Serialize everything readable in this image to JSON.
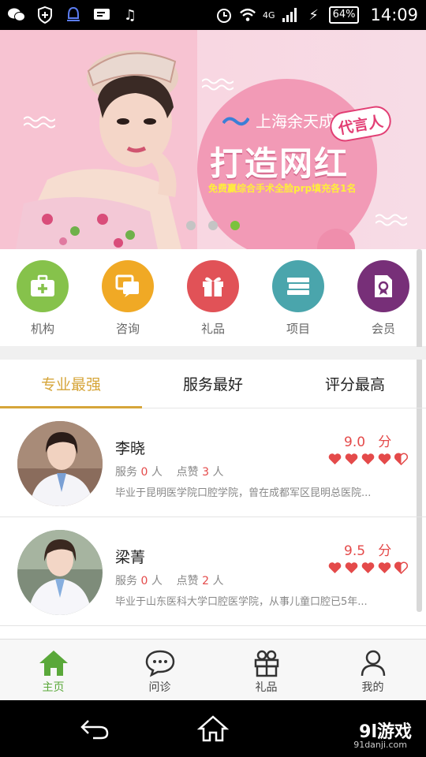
{
  "status_bar": {
    "battery": "64%",
    "network": "4G",
    "time": "14:09",
    "icons": [
      "wechat-icon",
      "shield-icon",
      "bell-icon",
      "message-icon",
      "music-icon",
      "alarm-icon",
      "wifi-icon",
      "signal-icon",
      "charging-icon"
    ]
  },
  "banner": {
    "brand": "上海余天成",
    "headline": "打造网红",
    "subline": "免费赢综合手术全脸prp填充各1名",
    "badge": "代言人",
    "slides": 3,
    "active_slide": 3
  },
  "categories": [
    {
      "label": "机构",
      "icon": "hospital-kit-icon",
      "color": "#86c24b"
    },
    {
      "label": "咨询",
      "icon": "chat-icon",
      "color": "#f0a925"
    },
    {
      "label": "礼品",
      "icon": "gift-icon",
      "color": "#e15257"
    },
    {
      "label": "项目",
      "icon": "books-icon",
      "color": "#4aa5ac"
    },
    {
      "label": "会员",
      "icon": "certificate-icon",
      "color": "#772f78"
    }
  ],
  "tabs": [
    {
      "label": "专业最强",
      "active": true
    },
    {
      "label": "服务最好",
      "active": false
    },
    {
      "label": "评分最高",
      "active": false
    }
  ],
  "doctors": [
    {
      "name": "李晓",
      "service_label": "服务",
      "service_count": "0",
      "people": "人",
      "likes_label": "点赞",
      "likes_count": "3",
      "score": "9.0",
      "score_unit": "分",
      "rating_hearts": 4.5,
      "desc": "毕业于昆明医学院口腔学院，曾在成都军区昆明总医院..."
    },
    {
      "name": "梁菁",
      "service_label": "服务",
      "service_count": "0",
      "people": "人",
      "likes_label": "点赞",
      "likes_count": "2",
      "score": "9.5",
      "score_unit": "分",
      "rating_hearts": 4.5,
      "desc": "毕业于山东医科大学口腔医学院，从事儿童口腔已5年..."
    }
  ],
  "bottom_nav": [
    {
      "label": "主页",
      "icon": "home-icon",
      "active": true
    },
    {
      "label": "问诊",
      "icon": "chat-bubble-icon",
      "active": false
    },
    {
      "label": "礼品",
      "icon": "gift-box-icon",
      "active": false
    },
    {
      "label": "我的",
      "icon": "user-icon",
      "active": false
    }
  ],
  "watermark": {
    "brand": "9l游戏",
    "url": "91danji.com"
  },
  "colors": {
    "accent": "#d6a53a",
    "green": "#7bc23c",
    "red": "#e44a4a"
  }
}
